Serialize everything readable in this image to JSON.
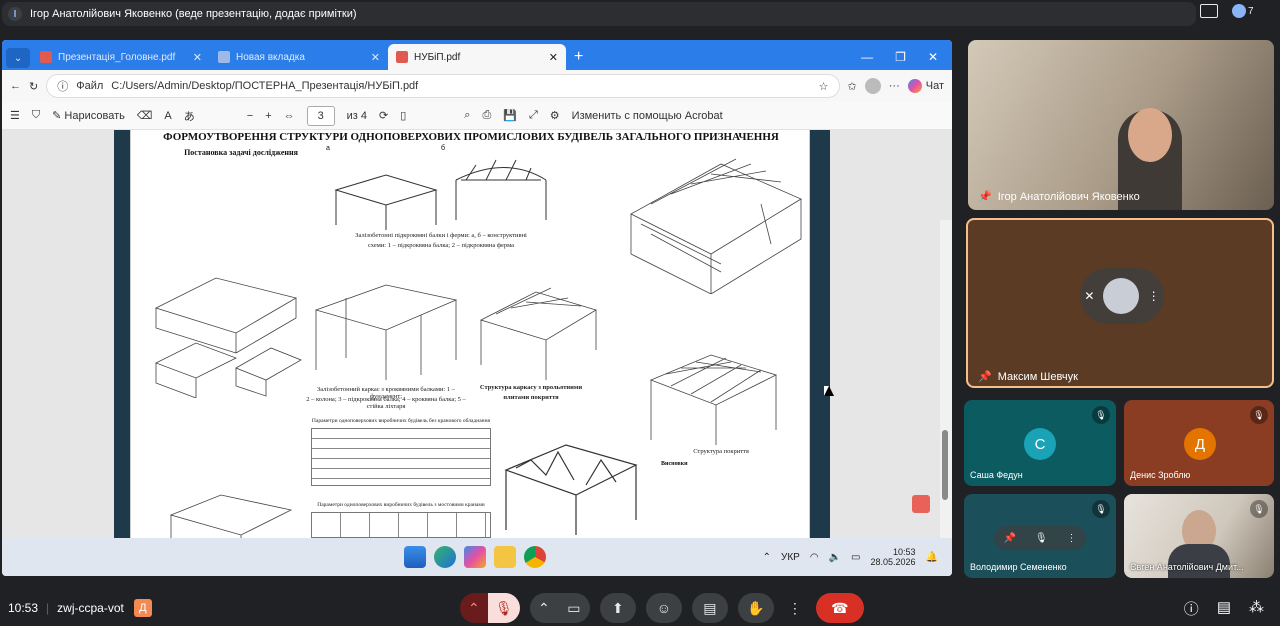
{
  "meet": {
    "presenter_initial": "І",
    "banner": "Ігор Анатолійович Яковенко (веде презентацію, додає примітки)",
    "people_count": "7",
    "time": "10:53",
    "meeting_code": "zwj-ccpa-vot",
    "self_initial": "Д"
  },
  "browser": {
    "tabs": [
      {
        "label": "Презентація_Головне.pdf"
      },
      {
        "label": "Новая вкладка"
      },
      {
        "label": "НУБіП.pdf"
      }
    ],
    "url_prefix": "Файл",
    "url": "C:/Users/Admin/Desktop/ПОСТЕРНА_Презентація/НУБіП.pdf",
    "chat_label": "Чат"
  },
  "pdf_toolbar": {
    "draw_label": "Нарисовать",
    "page_current": "3",
    "page_total": "из 4",
    "acrobat_label": "Изменить с помощью Acrobat"
  },
  "pdf": {
    "title": "ФОРМОУТВОРЕННЯ СТРУКТУРИ ОДНОПОВЕРХОВИХ ПРОМИСЛОВИХ  БУДІВЕЛЬ ЗАГАЛЬНОГО ПРИЗНАЧЕННЯ",
    "section": "Постановка задачі дослідження",
    "cap1a": "Залізобетонні підкроквяні балки і ферми: а, б – конструктивні",
    "cap1b": "схеми: 1 – підкроквяна балка; 2 – підкроквяна ферма",
    "cap2": "Залізобетонний каркас з кроквяними балками: 1 –фундамент;",
    "cap2b": "2 – колона; 3 – підкроквяна балка; 4 – кроквяна балка; 5 – стійка ліхтаря",
    "cap3": "Структура каркасу з прольотними",
    "cap3b": "плитами покриття",
    "cap4": "Структура покриття",
    "table1": "Параметри одноповерхових виробничих будівель без кранового обладнання",
    "table2": "Параметри одноповерхових виробничих будівель з мостовими кранами",
    "conclusion": "Висновки",
    "fig_a": "а",
    "fig_b": "б"
  },
  "taskbar": {
    "lang": "УКР",
    "time": "10:53",
    "date": "28.05.2026"
  },
  "participants": [
    {
      "name": "Ігор Анатолійович Яковенко"
    },
    {
      "name": "Максим Шевчук"
    },
    {
      "name": "Саша Федун",
      "initial": "С",
      "color": "#1a8a9b"
    },
    {
      "name": "Денис Зроблю",
      "initial": "Д",
      "color": "#e37400"
    },
    {
      "name": "Володимир Семененко"
    },
    {
      "name": "Євген Анатолійович Дмит..."
    }
  ]
}
